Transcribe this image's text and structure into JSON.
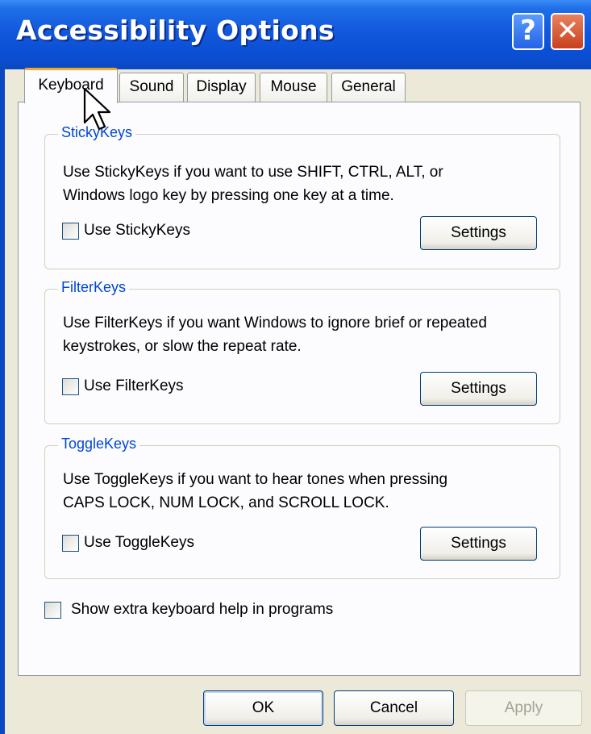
{
  "window": {
    "title": "Accessibility Options",
    "help_glyph": "?",
    "close_glyph": "✕"
  },
  "tabs": [
    {
      "label": "Keyboard",
      "active": true
    },
    {
      "label": "Sound",
      "active": false
    },
    {
      "label": "Display",
      "active": false
    },
    {
      "label": "Mouse",
      "active": false
    },
    {
      "label": "General",
      "active": false
    }
  ],
  "groups": {
    "stickykeys": {
      "legend": "StickyKeys",
      "desc_line1": "Use StickyKeys if you want to use SHIFT, CTRL, ALT, or",
      "desc_line2": "Windows logo key by pressing one key at a time.",
      "checkbox_label": "Use StickyKeys",
      "checked": false,
      "settings_label": "Settings"
    },
    "filterkeys": {
      "legend": "FilterKeys",
      "desc_line1": "Use FilterKeys if you want Windows to ignore brief or repeated",
      "desc_line2": "keystrokes, or slow the repeat rate.",
      "checkbox_label": "Use FilterKeys",
      "checked": false,
      "settings_label": "Settings"
    },
    "togglekeys": {
      "legend": "ToggleKeys",
      "desc_line1": "Use ToggleKeys if you want to hear tones when pressing",
      "desc_line2": "CAPS LOCK, NUM LOCK, and SCROLL LOCK.",
      "checkbox_label": "Use ToggleKeys",
      "checked": false,
      "settings_label": "Settings"
    }
  },
  "extra_help": {
    "label": "Show extra keyboard help in programs",
    "checked": false
  },
  "footer": {
    "ok_label": "OK",
    "cancel_label": "Cancel",
    "apply_label": "Apply",
    "apply_enabled": false
  },
  "colors": {
    "titlebar": "#1258dc",
    "group_legend": "#0046d5",
    "active_tab_accent": "#f5a623",
    "dialog_bg": "#ece9d8"
  },
  "icons": {
    "cursor": "arrow-cursor-icon",
    "help": "help-icon",
    "close": "close-icon"
  }
}
